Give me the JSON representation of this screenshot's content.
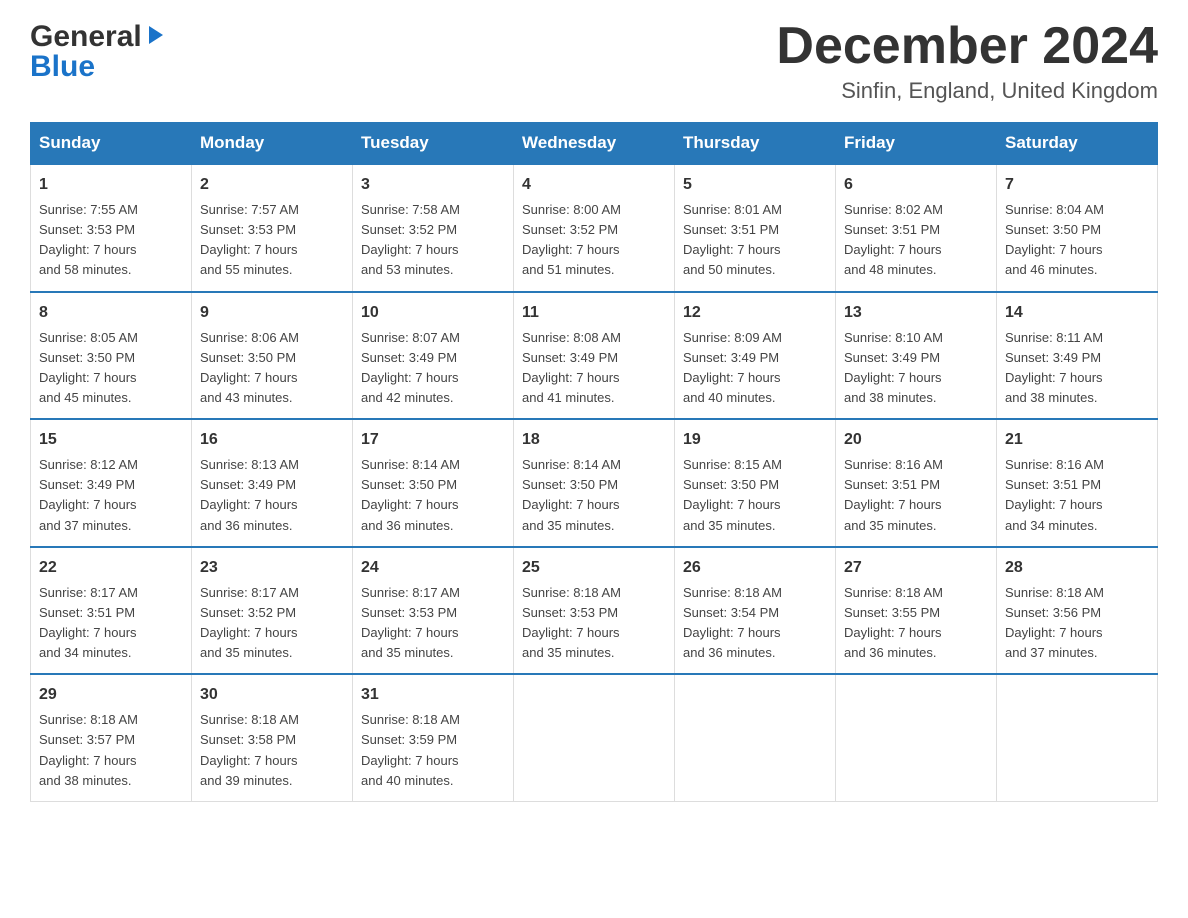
{
  "header": {
    "logo_general": "General",
    "logo_blue": "Blue",
    "month_title": "December 2024",
    "location": "Sinfin, England, United Kingdom"
  },
  "days_of_week": [
    "Sunday",
    "Monday",
    "Tuesday",
    "Wednesday",
    "Thursday",
    "Friday",
    "Saturday"
  ],
  "weeks": [
    [
      {
        "day": "1",
        "sunrise": "7:55 AM",
        "sunset": "3:53 PM",
        "daylight": "7 hours and 58 minutes."
      },
      {
        "day": "2",
        "sunrise": "7:57 AM",
        "sunset": "3:53 PM",
        "daylight": "7 hours and 55 minutes."
      },
      {
        "day": "3",
        "sunrise": "7:58 AM",
        "sunset": "3:52 PM",
        "daylight": "7 hours and 53 minutes."
      },
      {
        "day": "4",
        "sunrise": "8:00 AM",
        "sunset": "3:52 PM",
        "daylight": "7 hours and 51 minutes."
      },
      {
        "day": "5",
        "sunrise": "8:01 AM",
        "sunset": "3:51 PM",
        "daylight": "7 hours and 50 minutes."
      },
      {
        "day": "6",
        "sunrise": "8:02 AM",
        "sunset": "3:51 PM",
        "daylight": "7 hours and 48 minutes."
      },
      {
        "day": "7",
        "sunrise": "8:04 AM",
        "sunset": "3:50 PM",
        "daylight": "7 hours and 46 minutes."
      }
    ],
    [
      {
        "day": "8",
        "sunrise": "8:05 AM",
        "sunset": "3:50 PM",
        "daylight": "7 hours and 45 minutes."
      },
      {
        "day": "9",
        "sunrise": "8:06 AM",
        "sunset": "3:50 PM",
        "daylight": "7 hours and 43 minutes."
      },
      {
        "day": "10",
        "sunrise": "8:07 AM",
        "sunset": "3:49 PM",
        "daylight": "7 hours and 42 minutes."
      },
      {
        "day": "11",
        "sunrise": "8:08 AM",
        "sunset": "3:49 PM",
        "daylight": "7 hours and 41 minutes."
      },
      {
        "day": "12",
        "sunrise": "8:09 AM",
        "sunset": "3:49 PM",
        "daylight": "7 hours and 40 minutes."
      },
      {
        "day": "13",
        "sunrise": "8:10 AM",
        "sunset": "3:49 PM",
        "daylight": "7 hours and 38 minutes."
      },
      {
        "day": "14",
        "sunrise": "8:11 AM",
        "sunset": "3:49 PM",
        "daylight": "7 hours and 38 minutes."
      }
    ],
    [
      {
        "day": "15",
        "sunrise": "8:12 AM",
        "sunset": "3:49 PM",
        "daylight": "7 hours and 37 minutes."
      },
      {
        "day": "16",
        "sunrise": "8:13 AM",
        "sunset": "3:49 PM",
        "daylight": "7 hours and 36 minutes."
      },
      {
        "day": "17",
        "sunrise": "8:14 AM",
        "sunset": "3:50 PM",
        "daylight": "7 hours and 36 minutes."
      },
      {
        "day": "18",
        "sunrise": "8:14 AM",
        "sunset": "3:50 PM",
        "daylight": "7 hours and 35 minutes."
      },
      {
        "day": "19",
        "sunrise": "8:15 AM",
        "sunset": "3:50 PM",
        "daylight": "7 hours and 35 minutes."
      },
      {
        "day": "20",
        "sunrise": "8:16 AM",
        "sunset": "3:51 PM",
        "daylight": "7 hours and 35 minutes."
      },
      {
        "day": "21",
        "sunrise": "8:16 AM",
        "sunset": "3:51 PM",
        "daylight": "7 hours and 34 minutes."
      }
    ],
    [
      {
        "day": "22",
        "sunrise": "8:17 AM",
        "sunset": "3:51 PM",
        "daylight": "7 hours and 34 minutes."
      },
      {
        "day": "23",
        "sunrise": "8:17 AM",
        "sunset": "3:52 PM",
        "daylight": "7 hours and 35 minutes."
      },
      {
        "day": "24",
        "sunrise": "8:17 AM",
        "sunset": "3:53 PM",
        "daylight": "7 hours and 35 minutes."
      },
      {
        "day": "25",
        "sunrise": "8:18 AM",
        "sunset": "3:53 PM",
        "daylight": "7 hours and 35 minutes."
      },
      {
        "day": "26",
        "sunrise": "8:18 AM",
        "sunset": "3:54 PM",
        "daylight": "7 hours and 36 minutes."
      },
      {
        "day": "27",
        "sunrise": "8:18 AM",
        "sunset": "3:55 PM",
        "daylight": "7 hours and 36 minutes."
      },
      {
        "day": "28",
        "sunrise": "8:18 AM",
        "sunset": "3:56 PM",
        "daylight": "7 hours and 37 minutes."
      }
    ],
    [
      {
        "day": "29",
        "sunrise": "8:18 AM",
        "sunset": "3:57 PM",
        "daylight": "7 hours and 38 minutes."
      },
      {
        "day": "30",
        "sunrise": "8:18 AM",
        "sunset": "3:58 PM",
        "daylight": "7 hours and 39 minutes."
      },
      {
        "day": "31",
        "sunrise": "8:18 AM",
        "sunset": "3:59 PM",
        "daylight": "7 hours and 40 minutes."
      },
      null,
      null,
      null,
      null
    ]
  ],
  "labels": {
    "sunrise": "Sunrise:",
    "sunset": "Sunset:",
    "daylight": "Daylight:"
  }
}
